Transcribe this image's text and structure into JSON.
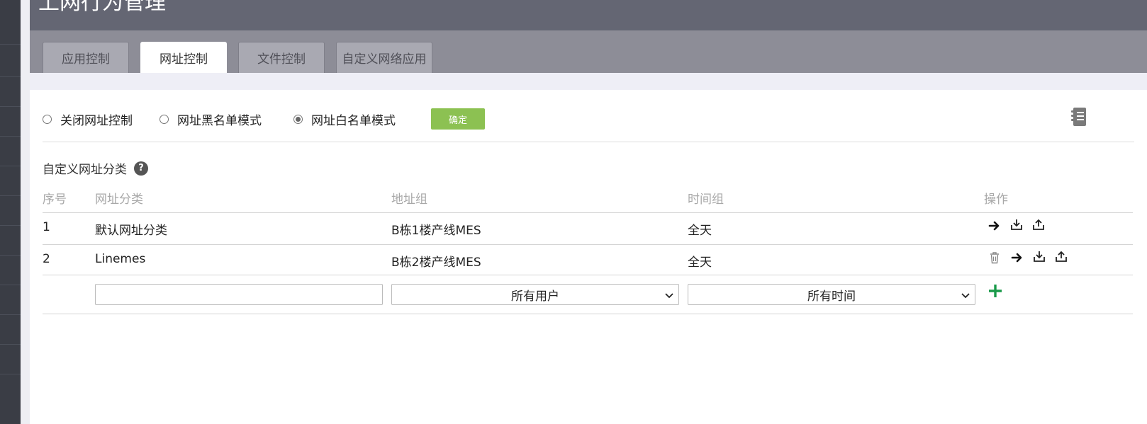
{
  "header": {
    "title": "上网行为管理"
  },
  "tabs": [
    {
      "label": "应用控制",
      "active": false
    },
    {
      "label": "网址控制",
      "active": true
    },
    {
      "label": "文件控制",
      "active": false
    },
    {
      "label": "自定义网络应用",
      "active": false
    }
  ],
  "mode": {
    "options": [
      "关闭网址控制",
      "网址黑名单模式",
      "网址白名单模式"
    ],
    "selected": "网址白名单模式",
    "confirm_label": "确定"
  },
  "section": {
    "title": "自定义网址分类",
    "help_glyph": "?"
  },
  "table": {
    "columns": [
      "序号",
      "网址分类",
      "地址组",
      "时间组",
      "操作"
    ],
    "rows": [
      {
        "index": "1",
        "category": "默认网址分类",
        "address_group": "B栋1楼产线MES",
        "time_group": "全天",
        "actions": [
          "arrow-right-icon",
          "download-icon",
          "upload-icon"
        ]
      },
      {
        "index": "2",
        "category": "Linemes",
        "address_group": "B栋2楼产线MES",
        "time_group": "全天",
        "actions": [
          "trash-icon",
          "arrow-right-icon",
          "download-icon",
          "upload-icon"
        ]
      }
    ],
    "new_row": {
      "category_value": "",
      "address_group_selected": "所有用户",
      "time_group_selected": "所有时间"
    }
  },
  "colors": {
    "header_bg": "#646673",
    "tabbar_bg": "#8d8d97",
    "confirm_bg": "#8cc152",
    "add_icon": "#1a9a4a"
  }
}
